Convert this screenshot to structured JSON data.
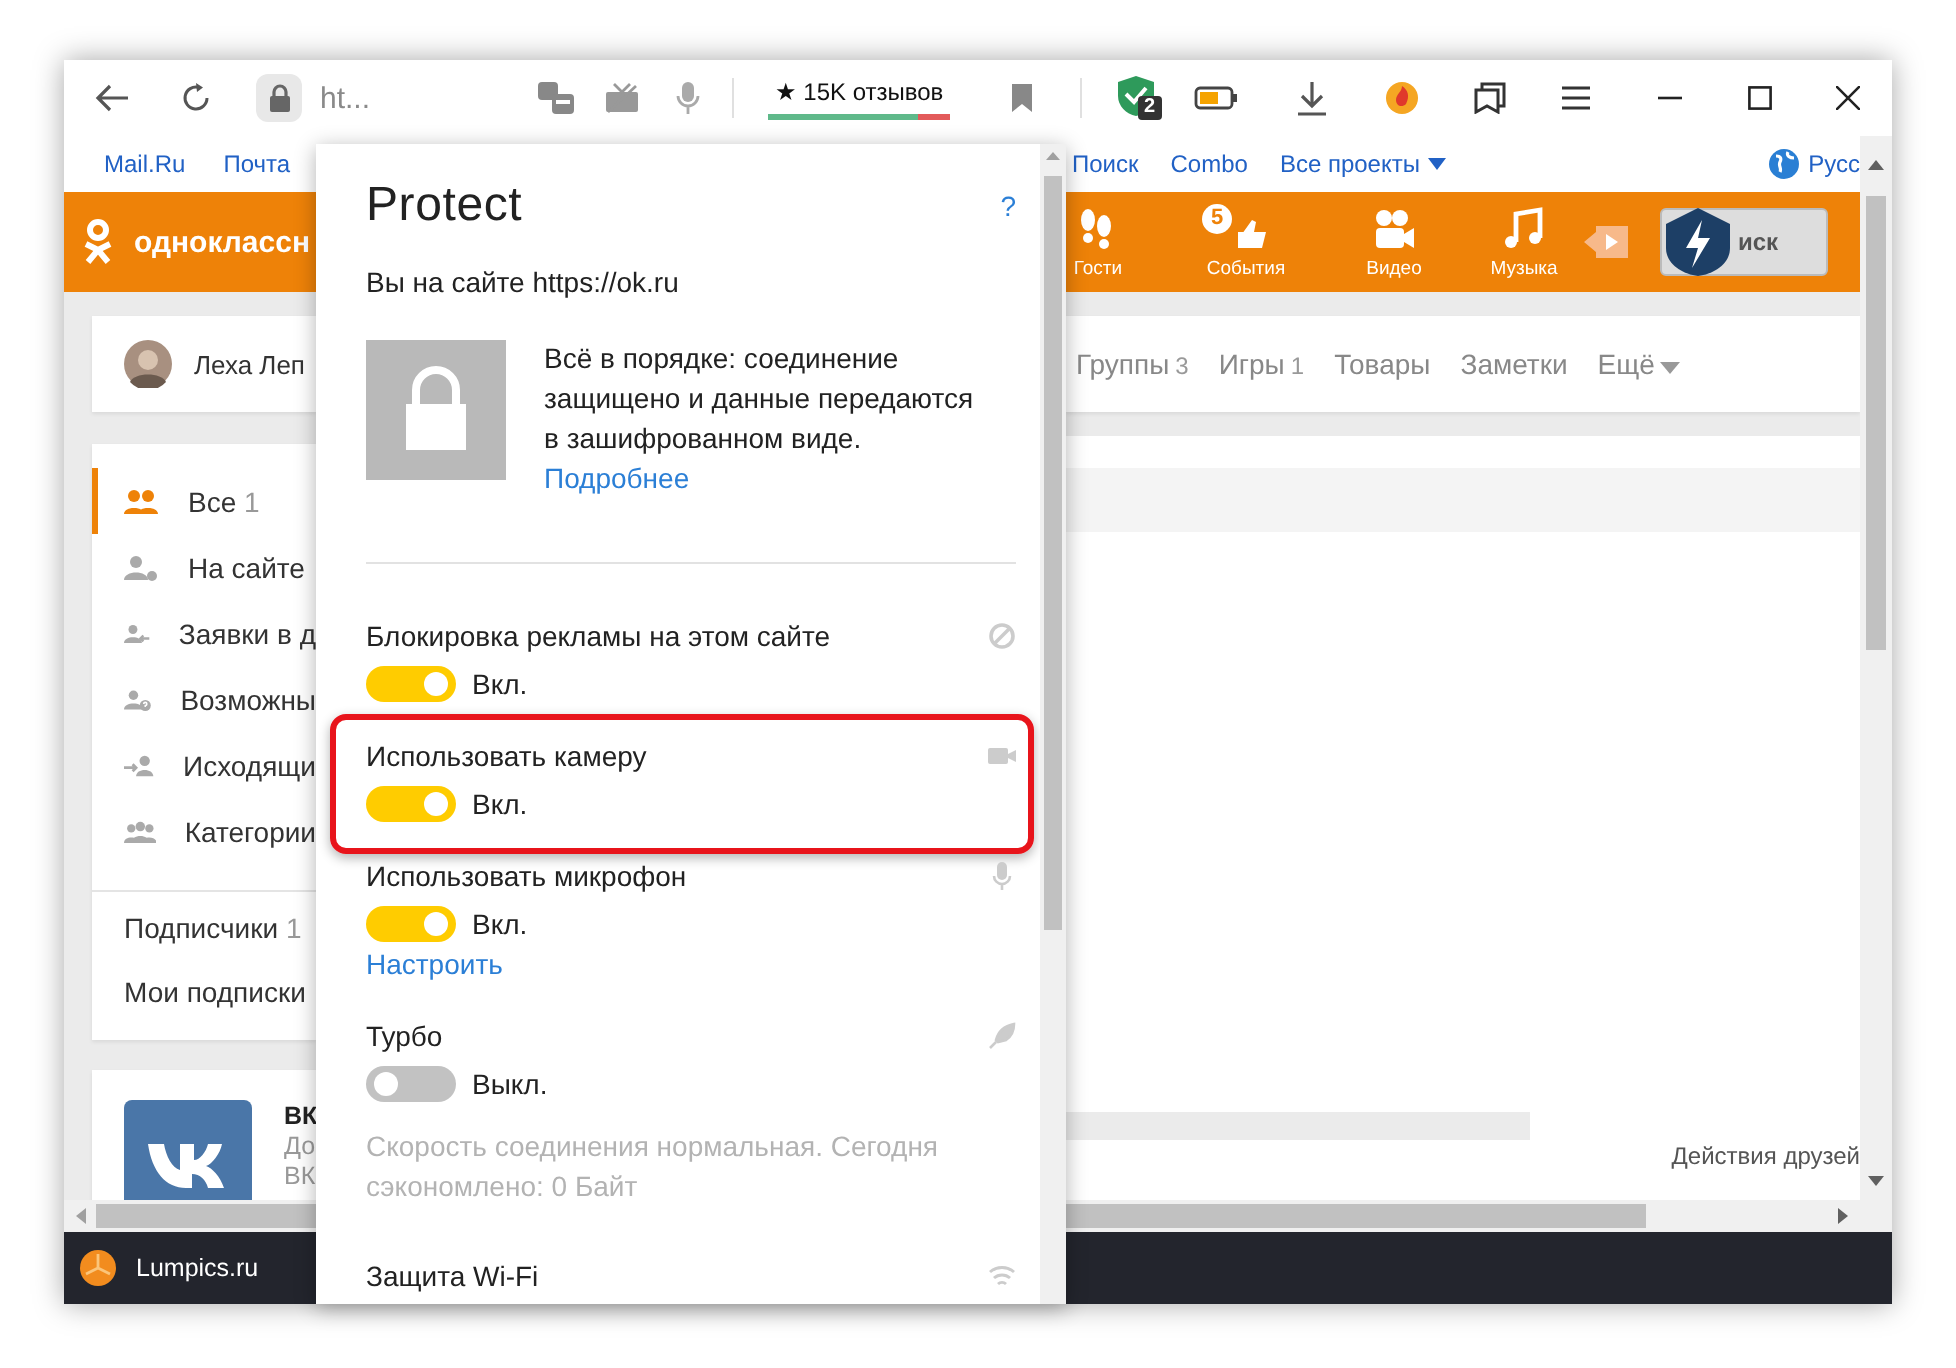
{
  "browser": {
    "address": "ht...",
    "reviews": {
      "label": "★ 15K отзывов",
      "level": 0.82
    },
    "extension_badge": "2"
  },
  "bookmarks": {
    "left": [
      "Mail.Ru",
      "Почта"
    ],
    "right": [
      "Поиск",
      "Combo",
      "Все проекты"
    ],
    "language": "Русс"
  },
  "site_header": {
    "logo": "одноклассн",
    "nav": [
      {
        "label": "Гости"
      },
      {
        "label": "События",
        "badge": "5"
      },
      {
        "label": "Видео"
      },
      {
        "label": "Музыка"
      }
    ],
    "search_button": "иск"
  },
  "profile": {
    "name": "Леха Леп",
    "tabs": [
      {
        "label": "Группы",
        "count": "3"
      },
      {
        "label": "Игры",
        "count": "1"
      },
      {
        "label": "Товары"
      },
      {
        "label": "Заметки"
      },
      {
        "label": "Ещё"
      }
    ]
  },
  "friends_menu": [
    {
      "kind": "all",
      "label": "Все",
      "count": "1",
      "selected": true
    },
    {
      "kind": "online",
      "label": "На сайте",
      "selected": false
    },
    {
      "kind": "requests",
      "label": "Заявки в д",
      "selected": false
    },
    {
      "kind": "possible",
      "label": "Возможны",
      "selected": false
    },
    {
      "kind": "outgoing",
      "label": "Исходящи",
      "selected": false
    },
    {
      "kind": "categories",
      "label": "Категории",
      "selected": false
    }
  ],
  "subscriptions": [
    {
      "label": "Подписчики",
      "count": "1"
    },
    {
      "label": "Мои подписки"
    }
  ],
  "promo_card": {
    "title": "ВК",
    "lines": [
      "До",
      "ВК"
    ]
  },
  "friends_activity": {
    "title": "Действия друзей"
  },
  "taskbar": {
    "label": "Lumpics.ru"
  },
  "protect": {
    "title": "Protect",
    "help": "?",
    "site": "Вы на сайте https://ok.ru",
    "status": "Всё в порядке: соединение защищено и данные передаются в зашифрованном виде.",
    "more_link": "Подробнее",
    "sections": [
      {
        "title": "Блокировка рекламы на этом сайте",
        "on": true,
        "state": "Вкл.",
        "highlighted": false
      },
      {
        "title": "Использовать камеру",
        "on": true,
        "state": "Вкл.",
        "highlighted": true
      },
      {
        "title": "Использовать микрофон",
        "on": true,
        "state": "Вкл.",
        "highlighted": false,
        "link": "Настроить"
      },
      {
        "title": "Турбо",
        "on": false,
        "state": "Выкл.",
        "highlighted": false,
        "note": "Скорость соединения нормальная. Сегодня сэкономлено: 0 Байт"
      },
      {
        "title": "Защита Wi-Fi",
        "highlighted": false
      }
    ]
  }
}
